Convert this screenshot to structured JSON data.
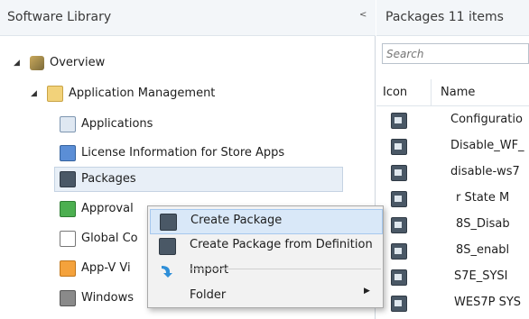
{
  "left_pane": {
    "title": "Software Library",
    "collapse_glyph": "<",
    "tree": [
      {
        "label": "Overview",
        "icon": "overview-icon",
        "expanded": true
      },
      {
        "label": "Application Management",
        "icon": "folder-icon",
        "expanded": true
      },
      {
        "label": "Applications",
        "icon": "applications-icon"
      },
      {
        "label": "License Information for Store Apps",
        "icon": "license-icon"
      },
      {
        "label": "Packages",
        "icon": "package-icon",
        "selected": true
      },
      {
        "label": "Approval",
        "icon": "approval-icon"
      },
      {
        "label": "Global Co",
        "icon": "global-conditions-icon"
      },
      {
        "label": "App-V Vi",
        "icon": "appv-icon"
      },
      {
        "label": "Windows",
        "icon": "windows-sideloading-icon"
      }
    ]
  },
  "right_pane": {
    "title": "Packages 11 items",
    "search_placeholder": "Search",
    "columns": [
      "Icon",
      "Name"
    ],
    "rows": [
      {
        "name": "Configuratio"
      },
      {
        "name": "Disable_WF_"
      },
      {
        "name": "disable-ws7"
      },
      {
        "name": "r State M"
      },
      {
        "name": "8S_Disab"
      },
      {
        "name": "8S_enabl"
      },
      {
        "name": "S7E_SYSI"
      },
      {
        "name": "WES7P SYS"
      }
    ]
  },
  "context_menu": {
    "items": [
      {
        "label": "Create Package",
        "icon": "package-icon",
        "highlighted": true
      },
      {
        "label": "Create Package from Definition",
        "icon": "package-icon"
      },
      {
        "label": "Import",
        "icon": "import-arrow-icon"
      },
      {
        "label": "Folder",
        "submenu": true
      }
    ]
  },
  "colors": {
    "header_bg": "#f3f6f9",
    "selection_bg": "#e8eff7",
    "menu_highlight": "#d9e8f8",
    "menu_bg": "#f2f2f2"
  }
}
